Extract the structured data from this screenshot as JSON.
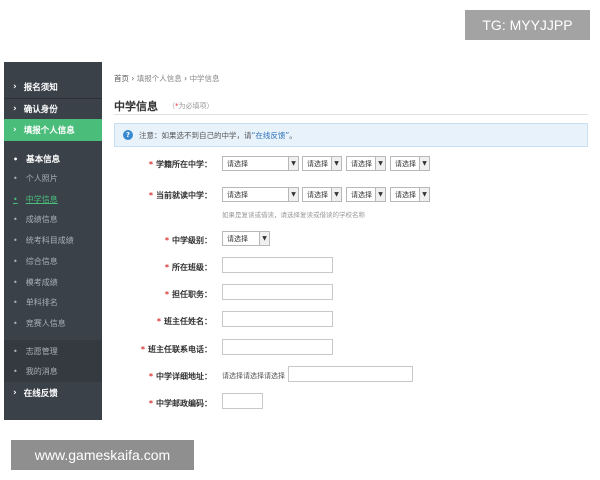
{
  "watermarks": {
    "top": "TG: MYYJJPP",
    "bottom": "www.gameskaifa.com"
  },
  "sidebar": {
    "top_items": [
      {
        "label": "报名须知"
      },
      {
        "label": "确认身份"
      },
      {
        "label": "填报个人信息"
      }
    ],
    "section_label": "基本信息",
    "sub_items": [
      {
        "label": "个人照片"
      },
      {
        "label": "中学信息"
      },
      {
        "label": "成绩信息"
      },
      {
        "label": "统考科目成绩"
      },
      {
        "label": "综合信息"
      },
      {
        "label": "模考成绩"
      },
      {
        "label": "单科排名"
      },
      {
        "label": "竞赛人信息"
      }
    ],
    "bottom_items": [
      {
        "label": "志愿管理"
      },
      {
        "label": "我的消息"
      }
    ],
    "feedback_label": "在线反馈"
  },
  "breadcrumb": {
    "home": "首页",
    "step": "填报个人信息",
    "current": "中学信息"
  },
  "page": {
    "title": "中学信息",
    "required_note": "为必填项",
    "required_star": "*"
  },
  "notice": {
    "icon": "?",
    "text": "注意：如果选不到自己的中学，请",
    "link": "在线反馈",
    "suffix": "。"
  },
  "form": {
    "school_location": {
      "label": "学籍所在中学：",
      "selects": [
        "请选择",
        "请选择",
        "请选择",
        "请选择"
      ]
    },
    "current_school": {
      "label": "当前就读中学：",
      "selects": [
        "请选择",
        "请选择",
        "请选择",
        "请选择"
      ],
      "hint": "如果是复读或借读，请选择复读或借读的学校名称"
    },
    "school_level": {
      "label": "中学级别：",
      "select": "请选择"
    },
    "class": {
      "label": "所在班级：",
      "value": ""
    },
    "position": {
      "label": "担任职务：",
      "value": ""
    },
    "head_teacher": {
      "label": "班主任姓名：",
      "value": ""
    },
    "head_teacher_phone": {
      "label": "班主任联系电话：",
      "value": ""
    },
    "school_address": {
      "label": "中学详细地址：",
      "prefix": "请选择请选择请选择",
      "value": ""
    },
    "postal_code": {
      "label": "中学邮政编码：",
      "value": ""
    }
  }
}
